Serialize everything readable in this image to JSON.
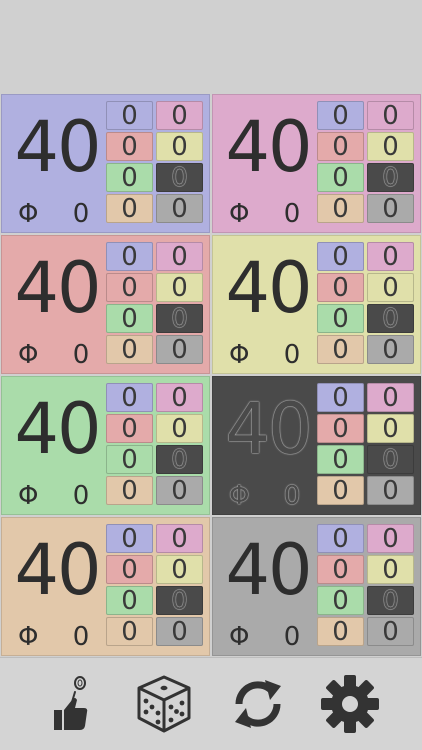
{
  "players": [
    {
      "id": "p1",
      "color": "#b0b0e0",
      "life": "40",
      "phi_label": "Φ",
      "poison": "0",
      "commander": [
        "0",
        "0",
        "0",
        "0",
        "0",
        "0",
        "0",
        "0"
      ]
    },
    {
      "id": "p2",
      "color": "#ddaacc",
      "life": "40",
      "phi_label": "Φ",
      "poison": "0",
      "commander": [
        "0",
        "0",
        "0",
        "0",
        "0",
        "0",
        "0",
        "0"
      ]
    },
    {
      "id": "p3",
      "color": "#e4aaaa",
      "life": "40",
      "phi_label": "Φ",
      "poison": "0",
      "commander": [
        "0",
        "0",
        "0",
        "0",
        "0",
        "0",
        "0",
        "0"
      ]
    },
    {
      "id": "p4",
      "color": "#e0e0aa",
      "life": "40",
      "phi_label": "Φ",
      "poison": "0",
      "commander": [
        "0",
        "0",
        "0",
        "0",
        "0",
        "0",
        "0",
        "0"
      ]
    },
    {
      "id": "p5",
      "color": "#aadcaa",
      "life": "40",
      "phi_label": "Φ",
      "poison": "0",
      "commander": [
        "0",
        "0",
        "0",
        "0",
        "0",
        "0",
        "0",
        "0"
      ]
    },
    {
      "id": "p6",
      "color": "#4a4a4a",
      "life": "40",
      "phi_label": "Φ",
      "poison": "0",
      "commander": [
        "0",
        "0",
        "0",
        "0",
        "0",
        "0",
        "0",
        "0"
      ]
    },
    {
      "id": "p7",
      "color": "#e2c8aa",
      "life": "40",
      "phi_label": "Φ",
      "poison": "0",
      "commander": [
        "0",
        "0",
        "0",
        "0",
        "0",
        "0",
        "0",
        "0"
      ]
    },
    {
      "id": "p8",
      "color": "#aaaaaa",
      "life": "40",
      "phi_label": "Φ",
      "poison": "0",
      "commander": [
        "0",
        "0",
        "0",
        "0",
        "0",
        "0",
        "0",
        "0"
      ]
    }
  ],
  "commander_colors": [
    "#b0b0e0",
    "#ddaacc",
    "#e4aaaa",
    "#e0e0aa",
    "#aadcaa",
    "#4a4a4a",
    "#e2c8aa",
    "#aaaaaa"
  ],
  "toolbar": [
    {
      "name": "coin-flip-icon"
    },
    {
      "name": "dice-icon"
    },
    {
      "name": "reset-icon"
    },
    {
      "name": "settings-icon"
    }
  ]
}
